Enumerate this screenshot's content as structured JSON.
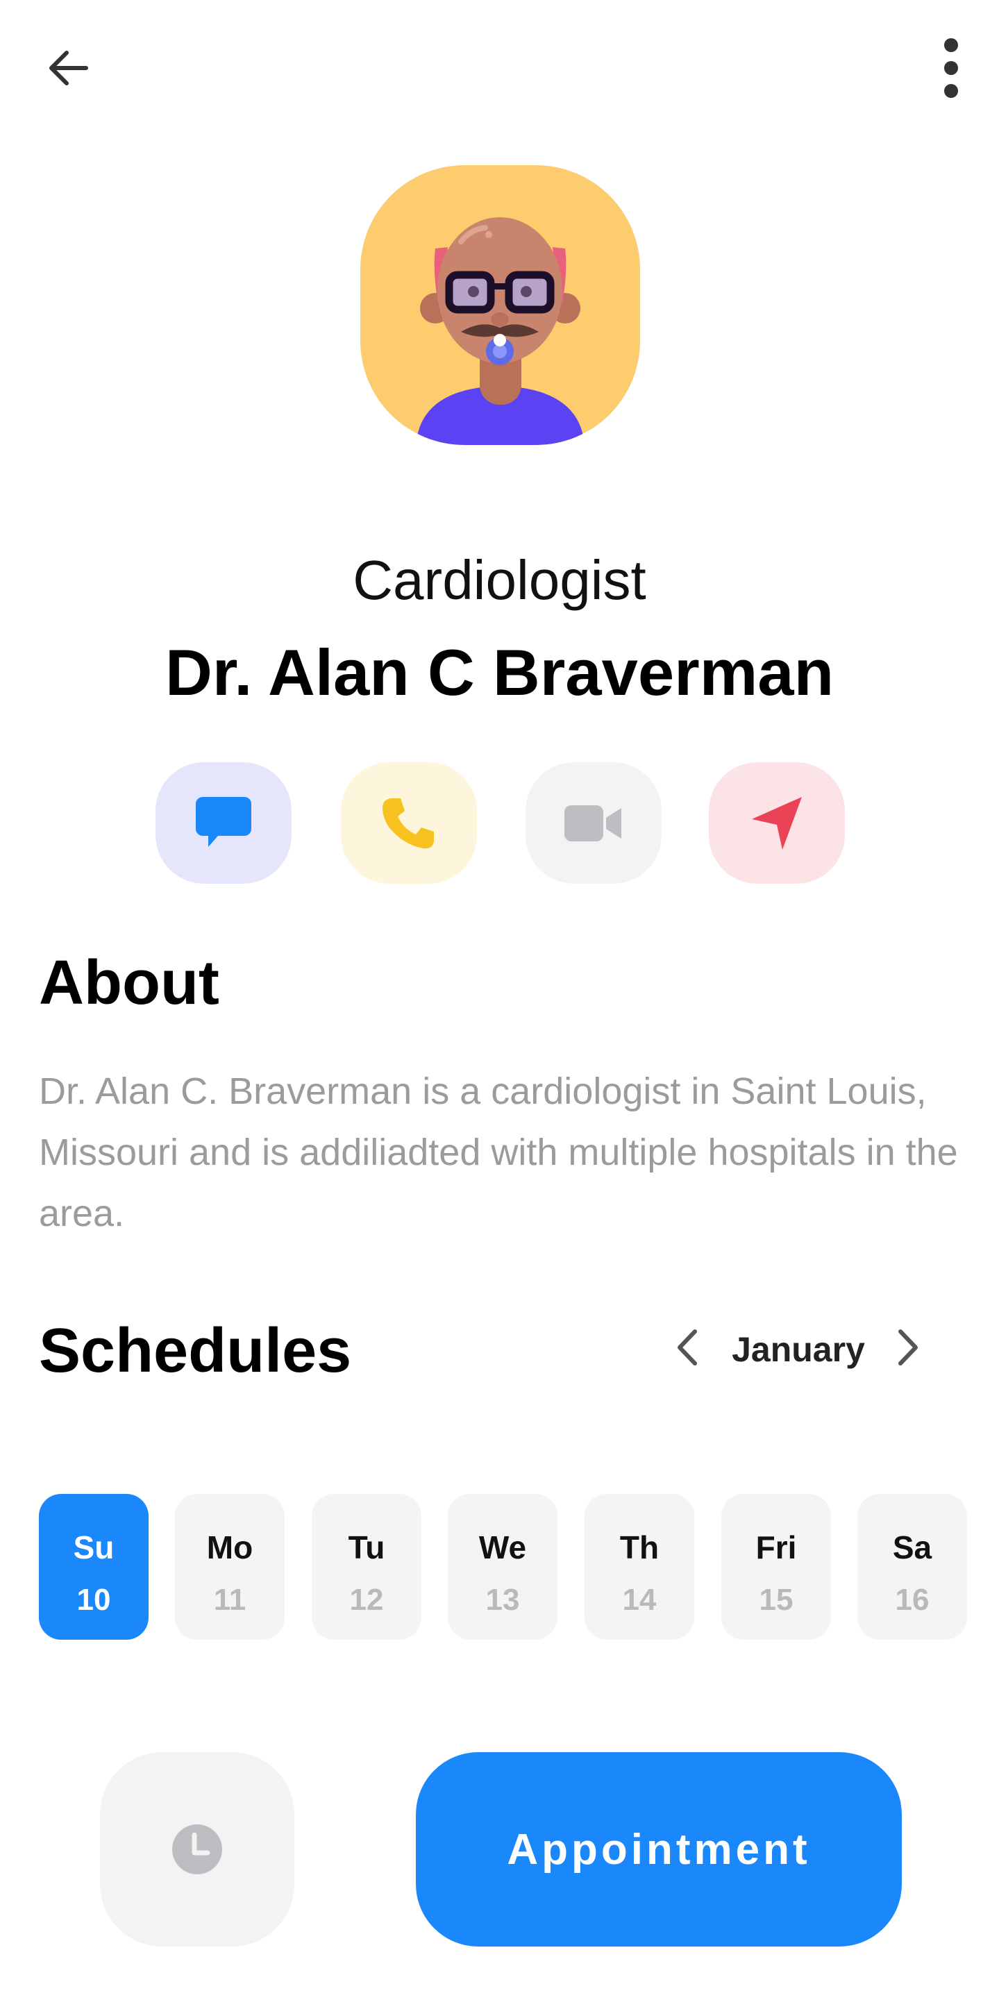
{
  "header": {
    "back_icon": "arrow-left-icon",
    "menu_icon": "more-vertical-icon"
  },
  "doctor": {
    "avatar_icon": "doctor-avatar",
    "specialty": "Cardiologist",
    "name": "Dr. Alan C Braverman"
  },
  "actions": [
    {
      "icon": "chat-icon",
      "color": "#1A88FB",
      "bg": "#E5E5FC"
    },
    {
      "icon": "phone-icon",
      "color": "#F7C21E",
      "bg": "#FEF5DD"
    },
    {
      "icon": "video-icon",
      "color": "#BDBDC2",
      "bg": "#F3F3F3"
    },
    {
      "icon": "navigation-icon",
      "color": "#EA4356",
      "bg": "#FCE3E6"
    }
  ],
  "about": {
    "title": "About",
    "text": "Dr. Alan C. Braverman is a cardiologist in Saint Louis, Missouri and is addiliadted with multiple hospitals in the area."
  },
  "schedules": {
    "title": "Schedules",
    "month": "January",
    "prev_icon": "chevron-left-icon",
    "next_icon": "chevron-right-icon",
    "days": [
      {
        "name": "Su",
        "date": "10",
        "selected": true
      },
      {
        "name": "Mo",
        "date": "11",
        "selected": false
      },
      {
        "name": "Tu",
        "date": "12",
        "selected": false
      },
      {
        "name": "We",
        "date": "13",
        "selected": false
      },
      {
        "name": "Th",
        "date": "14",
        "selected": false
      },
      {
        "name": "Fri",
        "date": "15",
        "selected": false
      },
      {
        "name": "Sa",
        "date": "16",
        "selected": false
      }
    ]
  },
  "footer": {
    "clock_icon": "clock-icon",
    "appointment_label": "Appointment"
  },
  "colors": {
    "accent": "#1A88FB",
    "avatar_bg": "#FDCC6E",
    "muted_text": "#9B9B9B"
  }
}
